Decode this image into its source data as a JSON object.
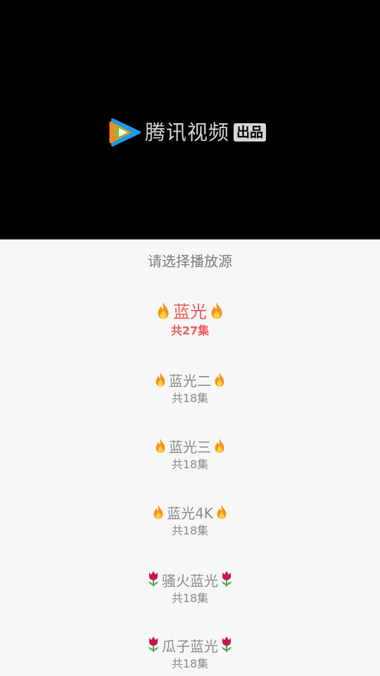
{
  "player": {
    "brand_name": "腾讯视频",
    "brand_badge": "出品",
    "logo_icon": "tencent-video-logo-icon"
  },
  "source_panel": {
    "title": "请选择播放源",
    "sources": [
      {
        "name": "蓝光",
        "count": "共27集",
        "decoration": "fire-icon",
        "selected": true
      },
      {
        "name": "蓝光二",
        "count": "共18集",
        "decoration": "fire-icon",
        "selected": false
      },
      {
        "name": "蓝光三",
        "count": "共18集",
        "decoration": "fire-icon",
        "selected": false
      },
      {
        "name": "蓝光4K",
        "count": "共18集",
        "decoration": "fire-icon",
        "selected": false
      },
      {
        "name": "骚火蓝光",
        "count": "共18集",
        "decoration": "tulip-icon",
        "selected": false
      },
      {
        "name": "瓜子蓝光",
        "count": "共18集",
        "decoration": "tulip-icon",
        "selected": false
      }
    ]
  },
  "colors": {
    "selected": "#f05a5a",
    "normal": "#8a8a8a",
    "panel_background": "#f7f7f7",
    "player_background": "#000000"
  }
}
